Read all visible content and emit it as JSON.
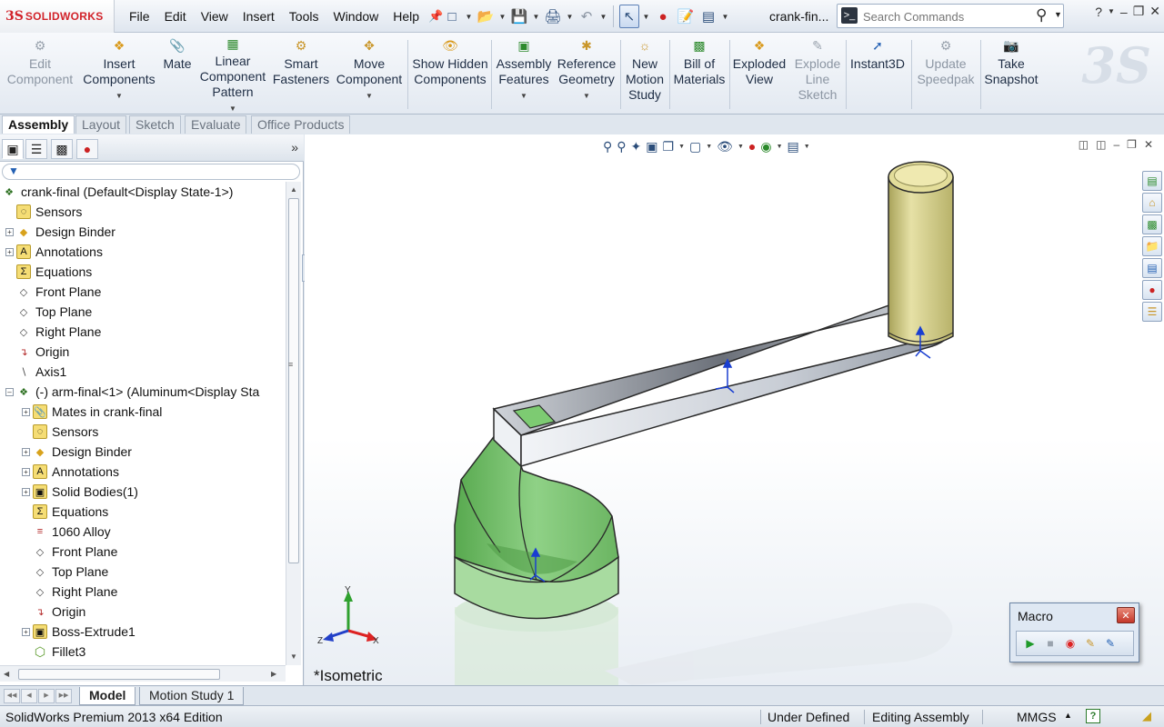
{
  "app": {
    "logo_text": "SOLIDWORKS",
    "doc_title": "crank-fin...",
    "menus": [
      "File",
      "Edit",
      "View",
      "Insert",
      "Tools",
      "Window",
      "Help"
    ],
    "search": {
      "placeholder": "Search Commands"
    }
  },
  "commandmanager": {
    "tools": [
      {
        "label": "Edit Component",
        "icon": "edit-component-icon",
        "enabled": false
      },
      {
        "label": "Insert Components",
        "icon": "insert-components-icon",
        "enabled": true
      },
      {
        "label": "Mate",
        "icon": "mate-icon",
        "enabled": true
      },
      {
        "label": "Linear Component Pattern",
        "icon": "linear-pattern-icon",
        "enabled": true
      },
      {
        "label": "Smart Fasteners",
        "icon": "smart-fasteners-icon",
        "enabled": true
      },
      {
        "label": "Move Component",
        "icon": "move-component-icon",
        "enabled": true
      },
      {
        "label": "Show Hidden Components",
        "icon": "show-hidden-icon",
        "enabled": true
      },
      {
        "label": "Assembly Features",
        "icon": "assembly-features-icon",
        "enabled": true
      },
      {
        "label": "Reference Geometry",
        "icon": "reference-geometry-icon",
        "enabled": true
      },
      {
        "label": "New Motion Study",
        "icon": "motion-study-icon",
        "enabled": true
      },
      {
        "label": "Bill of Materials",
        "icon": "bom-icon",
        "enabled": true
      },
      {
        "label": "Exploded View",
        "icon": "exploded-view-icon",
        "enabled": true
      },
      {
        "label": "Explode Line Sketch",
        "icon": "explode-line-icon",
        "enabled": false
      },
      {
        "label": "Instant3D",
        "icon": "instant3d-icon",
        "enabled": true
      },
      {
        "label": "Update Speedpak",
        "icon": "speedpak-icon",
        "enabled": false
      },
      {
        "label": "Take Snapshot",
        "icon": "snapshot-icon",
        "enabled": true
      }
    ],
    "tabs": [
      "Assembly",
      "Layout",
      "Sketch",
      "Evaluate",
      "Office Products"
    ],
    "active_tab": "Assembly"
  },
  "tree": {
    "root": "crank-final  (Default<Display State-1>)",
    "items": [
      {
        "label": "Sensors",
        "icon": "sensor-icon"
      },
      {
        "label": "Design Binder",
        "icon": "design-binder-icon"
      },
      {
        "label": "Annotations",
        "icon": "annotations-icon"
      },
      {
        "label": "Equations",
        "icon": "equations-icon"
      },
      {
        "label": "Front Plane",
        "icon": "plane-icon"
      },
      {
        "label": "Top Plane",
        "icon": "plane-icon"
      },
      {
        "label": "Right Plane",
        "icon": "plane-icon"
      },
      {
        "label": "Origin",
        "icon": "origin-icon"
      },
      {
        "label": "Axis1",
        "icon": "axis-icon"
      },
      {
        "label": "(-) arm-final<1> (Aluminum<Display Sta",
        "icon": "part-icon"
      },
      {
        "label": "Mates in crank-final",
        "icon": "mates-icon"
      },
      {
        "label": "Sensors",
        "icon": "sensor-icon"
      },
      {
        "label": "Design Binder",
        "icon": "design-binder-icon"
      },
      {
        "label": "Annotations",
        "icon": "annotations-icon"
      },
      {
        "label": "Solid Bodies(1)",
        "icon": "solid-bodies-icon"
      },
      {
        "label": "Equations",
        "icon": "equations-icon"
      },
      {
        "label": "1060 Alloy",
        "icon": "material-icon"
      },
      {
        "label": "Front Plane",
        "icon": "plane-icon"
      },
      {
        "label": "Top Plane",
        "icon": "plane-icon"
      },
      {
        "label": "Right Plane",
        "icon": "plane-icon"
      },
      {
        "label": "Origin",
        "icon": "origin-icon"
      },
      {
        "label": "Boss-Extrude1",
        "icon": "extrude-icon"
      },
      {
        "label": "Fillet3",
        "icon": "fillet-icon"
      }
    ]
  },
  "viewport": {
    "view_label": "*Isometric",
    "triad": {
      "x": "X",
      "y": "Y",
      "z": "Z"
    }
  },
  "macro": {
    "title": "Macro"
  },
  "bottom_tabs": [
    "Model",
    "Motion Study 1"
  ],
  "active_bottom_tab": "Model",
  "status": {
    "edition": "SolidWorks Premium 2013 x64 Edition",
    "definition": "Under Defined",
    "mode": "Editing Assembly",
    "units": "MMGS"
  },
  "colors": {
    "handle_yellow": "#d8d38a",
    "arm_gray": "#cfd4da",
    "base_green": "#5fae55",
    "brand_red": "#d2232a"
  }
}
